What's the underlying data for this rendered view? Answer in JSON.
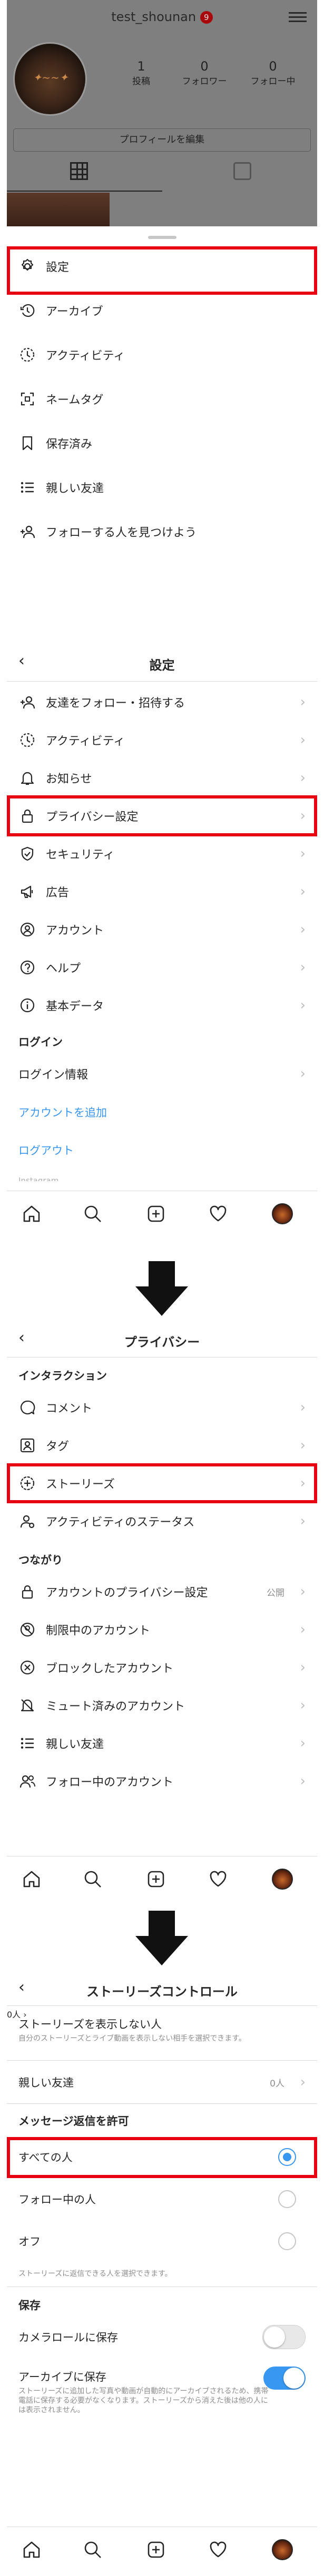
{
  "profile": {
    "username": "test_shounan",
    "notification_count": "9",
    "posts_count": "1",
    "posts_label": "投稿",
    "followers_count": "0",
    "followers_label": "フォロワー",
    "following_count": "0",
    "following_label": "フォロー中",
    "edit_profile_label": "プロフィールを編集"
  },
  "menu_sheet": {
    "items": [
      {
        "label": "設定",
        "icon": "settings-icon"
      },
      {
        "label": "アーカイブ",
        "icon": "archive-icon"
      },
      {
        "label": "アクティビティ",
        "icon": "activity-icon"
      },
      {
        "label": "ネームタグ",
        "icon": "nametag-icon"
      },
      {
        "label": "保存済み",
        "icon": "bookmark-icon"
      },
      {
        "label": "親しい友達",
        "icon": "close-friends-icon"
      },
      {
        "label": "フォローする人を見つけよう",
        "icon": "discover-people-icon"
      }
    ]
  },
  "settings_screen": {
    "title": "設定",
    "items": [
      {
        "label": "友達をフォロー・招待する",
        "icon": "add-person-icon"
      },
      {
        "label": "アクティビティ",
        "icon": "activity-icon"
      },
      {
        "label": "お知らせ",
        "icon": "bell-icon"
      },
      {
        "label": "プライバシー設定",
        "icon": "lock-icon"
      },
      {
        "label": "セキュリティ",
        "icon": "shield-icon"
      },
      {
        "label": "広告",
        "icon": "megaphone-icon"
      },
      {
        "label": "アカウント",
        "icon": "account-icon"
      },
      {
        "label": "ヘルプ",
        "icon": "help-icon"
      },
      {
        "label": "基本データ",
        "icon": "info-icon"
      }
    ],
    "login_header": "ログイン",
    "login_info_label": "ログイン情報",
    "add_account_link": "アカウントを追加",
    "logout_link": "ログアウト",
    "cut_text": "Instagram"
  },
  "privacy_screen": {
    "title": "プライバシー",
    "interaction_header": "インタラクション",
    "interaction_items": [
      {
        "label": "コメント",
        "icon": "comment-icon"
      },
      {
        "label": "タグ",
        "icon": "tag-icon"
      },
      {
        "label": "ストーリーズ",
        "icon": "story-icon"
      },
      {
        "label": "アクティビティのステータス",
        "icon": "activity-status-icon"
      }
    ],
    "connections_header": "つながり",
    "connection_items": [
      {
        "label": "アカウントのプライバシー設定",
        "icon": "lock-icon",
        "value": "公開"
      },
      {
        "label": "制限中のアカウント",
        "icon": "restricted-icon",
        "value": ""
      },
      {
        "label": "ブロックしたアカウント",
        "icon": "blocked-icon",
        "value": ""
      },
      {
        "label": "ミュート済みのアカウント",
        "icon": "muted-icon",
        "value": ""
      },
      {
        "label": "親しい友達",
        "icon": "close-friends-icon",
        "value": ""
      },
      {
        "label": "フォロー中のアカウント",
        "icon": "following-icon",
        "value": ""
      }
    ]
  },
  "story_controls": {
    "title": "ストーリーズコントロール",
    "hide_story_label": "ストーリーズを表示しない人",
    "hide_story_value": "0人",
    "hide_story_desc": "自分のストーリーズとライブ動画を表示しない相手を選択できます。",
    "close_friends_label": "親しい友達",
    "close_friends_value": "0人",
    "reply_header": "メッセージ返信を許可",
    "reply_options": [
      {
        "label": "すべての人",
        "selected": true
      },
      {
        "label": "フォロー中の人",
        "selected": false
      },
      {
        "label": "オフ",
        "selected": false
      }
    ],
    "reply_hint": "ストーリーズに返信できる人を選択できます。",
    "save_header": "保存",
    "camera_roll_label": "カメラロールに保存",
    "camera_roll_on": false,
    "archive_label": "アーカイブに保存",
    "archive_on": true,
    "archive_desc": "ストーリーズに追加した写真や動画が自動的にアーカイブされるため、携帯電話に保存する必要がなくなります。ストーリーズから消えた後は他の人には表示されません。"
  },
  "tabbar": {
    "tabs": [
      "home-icon",
      "search-icon",
      "new-post-icon",
      "heart-icon",
      "profile-avatar"
    ]
  },
  "colors": {
    "highlight": "#e60012",
    "link": "#3897f0",
    "toggle_on": "#3897f0"
  }
}
